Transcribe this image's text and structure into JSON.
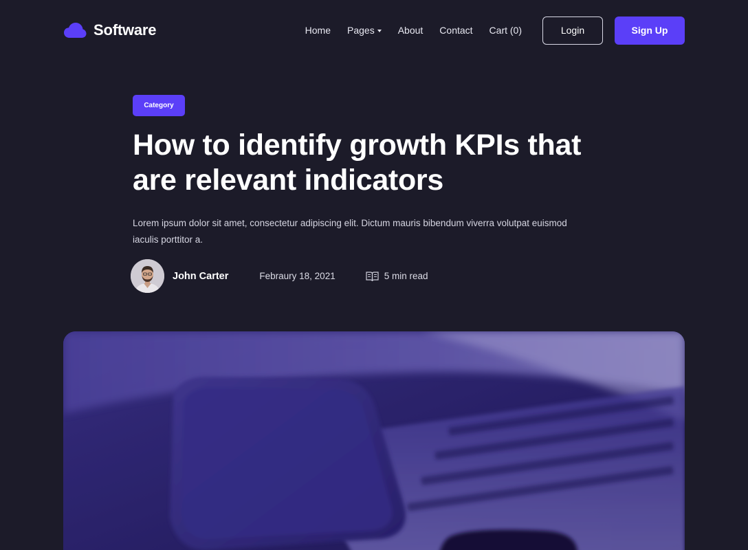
{
  "brand": {
    "name": "Software",
    "icon": "cloud-icon",
    "accent": "#5b3ff8"
  },
  "nav": {
    "home": "Home",
    "pages": "Pages",
    "about": "About",
    "contact": "Contact",
    "cart": "Cart (0)"
  },
  "auth": {
    "login": "Login",
    "signup": "Sign Up"
  },
  "article": {
    "category": "Category",
    "title": "How to identify growth KPIs that are relevant indicators",
    "excerpt": "Lorem ipsum dolor sit amet, consectetur adipiscing elit. Dictum mauris bibendum viverra volutpat euismod iaculis porttitor a.",
    "author": "John Carter",
    "date": "Febraury 18, 2021",
    "read_time": "5 min read",
    "read_icon": "book-icon"
  },
  "colors": {
    "background": "#1c1b29",
    "accent": "#5b3ff8",
    "text": "#ffffff"
  }
}
